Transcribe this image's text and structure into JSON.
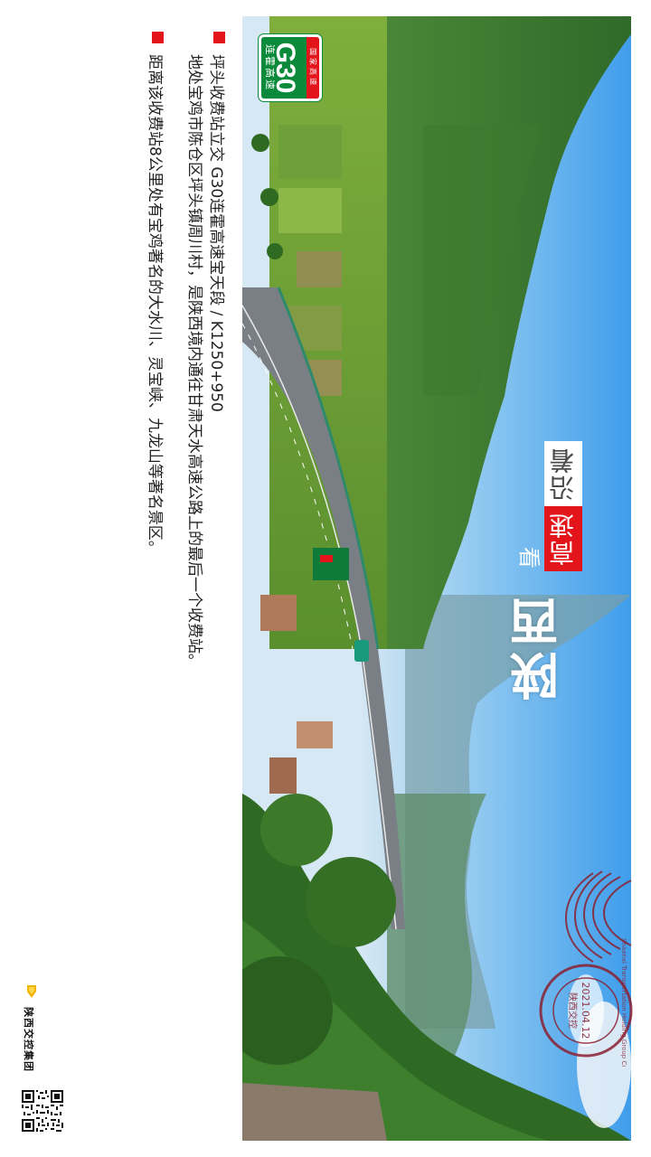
{
  "title": {
    "yan_zhe": "沿着",
    "gao_su": "高速",
    "kan": "看",
    "shaan_xi": "陕西"
  },
  "shield": {
    "band": "国家高速",
    "code": "G30",
    "name": "连霍高速"
  },
  "stamp": {
    "ring_text": "Shaanxi Transportation Holding Group Co.,Ltd",
    "org": "陕西交控",
    "date": "2021.04.12"
  },
  "content": {
    "line1": "坪头收费站立交  G30连霍高速宝天段 / K1250+950",
    "line2": "地处宝鸡市陈仓区坪头镇周川村，是陕西境内通往甘肃天水高速公路上的最后一个收费站。",
    "line3": "距离该收费站8公里处有宝鸡著名的大水川、灵宝峡、九龙山等著名景区。"
  },
  "footer": {
    "logo_text": "陕西交控集团"
  },
  "colors": {
    "accent_red": "#e3141a",
    "shield_green": "#0a8a3a",
    "stamp_ink": "#8a2030",
    "sky_blue": "#4aa6f0"
  }
}
